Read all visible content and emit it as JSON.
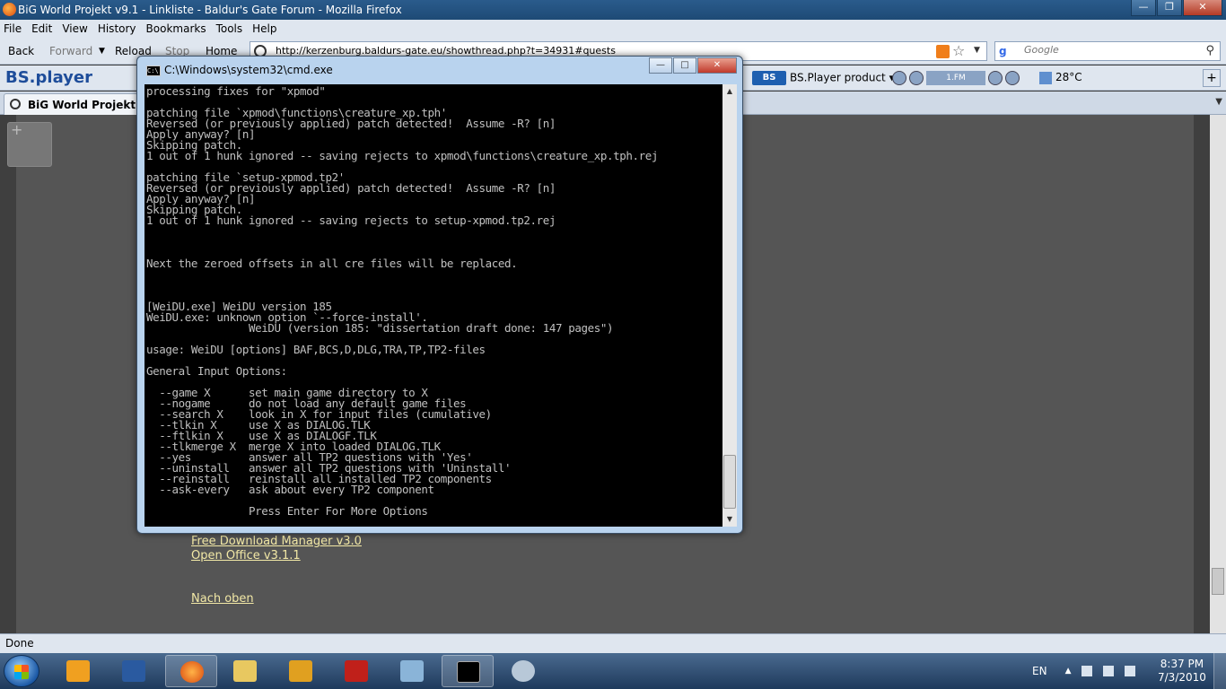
{
  "firefox": {
    "title": "BiG World Projekt v9.1 - Linkliste - Baldur's Gate Forum - Mozilla Firefox",
    "menu": [
      "File",
      "Edit",
      "View",
      "History",
      "Bookmarks",
      "Tools",
      "Help"
    ],
    "nav": {
      "back": "Back",
      "forward": "Forward",
      "reload": "Reload",
      "stop": "Stop",
      "home": "Home"
    },
    "url": "http://kerzenburg.baldurs-gate.eu/showthread.php?t=34931#quests",
    "search_placeholder": "Google",
    "toolbar2": {
      "logo": "BS.player",
      "product": "BS.Player product",
      "station": "1.FM",
      "temperature": "28°C"
    },
    "tab_label": "BiG World Projekt v9.1",
    "status": "Done"
  },
  "page": {
    "links": [
      "Free Download Manager v3.0",
      "Open Office v3.1.1"
    ],
    "top_link": "Nach oben"
  },
  "cmd": {
    "title": "C:\\Windows\\system32\\cmd.exe",
    "output": "processing fixes for \"xpmod\"\n\npatching file `xpmod\\functions\\creature_xp.tph'\nReversed (or previously applied) patch detected!  Assume -R? [n]\nApply anyway? [n]\nSkipping patch.\n1 out of 1 hunk ignored -- saving rejects to xpmod\\functions\\creature_xp.tph.rej\n\npatching file `setup-xpmod.tp2'\nReversed (or previously applied) patch detected!  Assume -R? [n]\nApply anyway? [n]\nSkipping patch.\n1 out of 1 hunk ignored -- saving rejects to setup-xpmod.tp2.rej\n\n\n\nNext the zeroed offsets in all cre files will be replaced.\n\n\n\n[WeiDU.exe] WeiDU version 185\nWeiDU.exe: unknown option `--force-install'.\n                WeiDU (version 185: \"dissertation draft done: 147 pages\")\n\nusage: WeiDU [options] BAF,BCS,D,DLG,TRA,TP,TP2-files\n\nGeneral Input Options:\n\n  --game X      set main game directory to X\n  --nogame      do not load any default game files\n  --search X    look in X for input files (cumulative)\n  --tlkin X     use X as DIALOG.TLK\n  --ftlkin X    use X as DIALOGF.TLK\n  --tlkmerge X  merge X into loaded DIALOG.TLK\n  --yes         answer all TP2 questions with 'Yes'\n  --uninstall   answer all TP2 questions with 'Uninstall'\n  --reinstall   reinstall all installed TP2 components\n  --ask-every   ask about every TP2 component\n\n                Press Enter For More Options\n_"
  },
  "taskbar": {
    "lang": "EN",
    "time": "8:37 PM",
    "date": "7/3/2010"
  }
}
